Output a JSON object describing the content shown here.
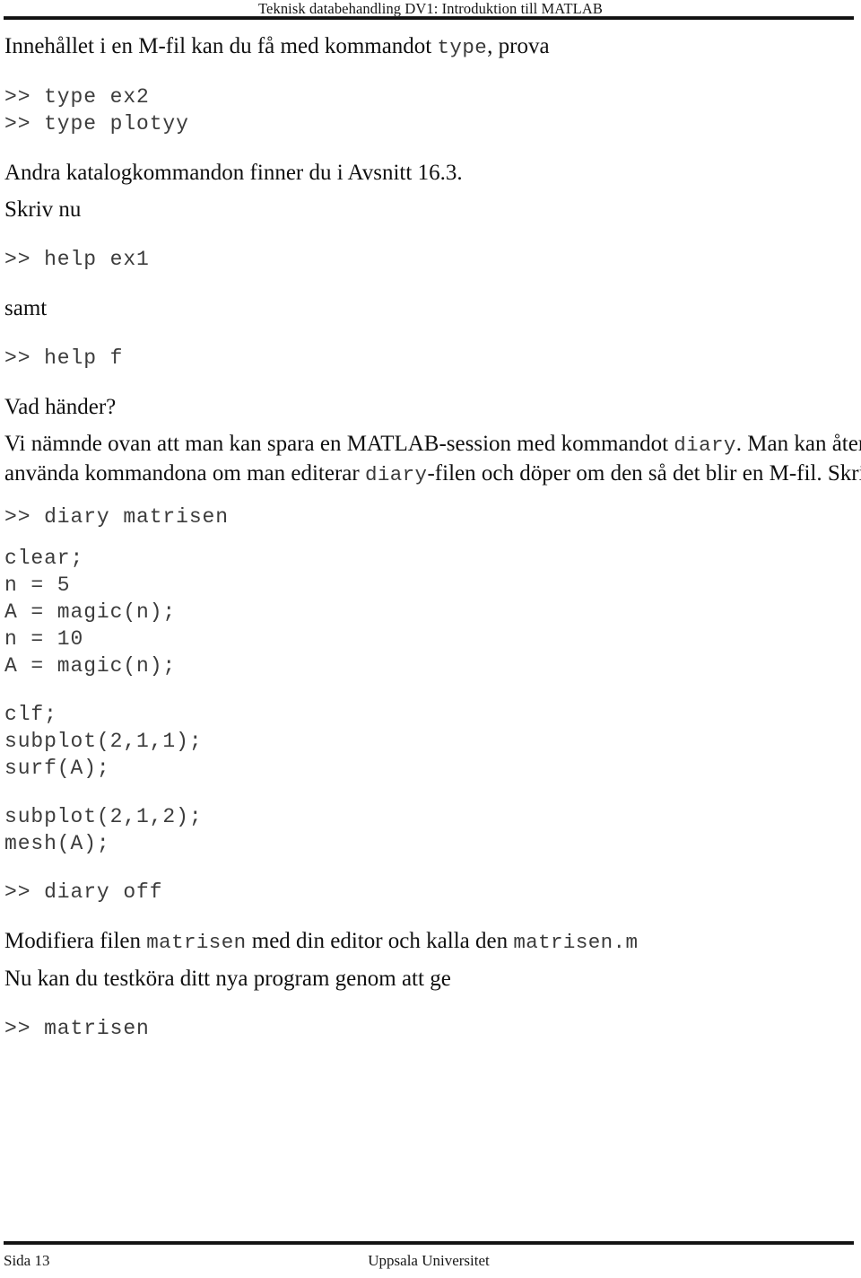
{
  "document": {
    "running_header": "Teknisk databehandling DV1: Introduktion till MATLAB",
    "language": "sv"
  },
  "content": {
    "intro_line": {
      "before": "Innehållet i en M-fil kan du få med kommandot ",
      "code": "type",
      "after": ", prova"
    },
    "code_type_block": ">> type ex2\n>> type plotyy",
    "para_avsnitt": "Andra katalogkommandon finner du i Avsnitt 16.3.",
    "para_skriv_nu": "Skriv nu",
    "code_help_ex1": ">> help ex1",
    "para_samt": "samt",
    "code_help_f": ">> help f",
    "para_vad_hander": "Vad händer?",
    "para_diary": {
      "line1_before": "Vi nämnde ovan att man kan spara en MATLAB-session med kommandot ",
      "code1": "diary",
      "line1_after": ". Man kan åter-",
      "line2_before": "använda kommandona om man editerar ",
      "code2": "diary",
      "line2_after": "-filen och döper om den så det blir en M-fil. Skriv:"
    },
    "code_diary_start": ">> diary matrisen",
    "code_matrix_block": "clear;\nn = 5\nA = magic(n);\nn = 10\nA = magic(n);",
    "code_plot_block_1": "clf;\nsubplot(2,1,1);\nsurf(A);",
    "code_plot_block_2": "subplot(2,1,2);\nmesh(A);",
    "code_diary_off": ">> diary off",
    "para_modifiera": {
      "before": "Modifiera filen ",
      "code1": "matrisen",
      "middle": " med din editor och kalla den ",
      "code2": "matrisen.m"
    },
    "para_testkora": "Nu kan du testköra ditt nya program genom att ge",
    "code_matrisen": ">> matrisen"
  },
  "footer": {
    "page_label": "Sida 13",
    "organization": "Uppsala Universitet"
  }
}
